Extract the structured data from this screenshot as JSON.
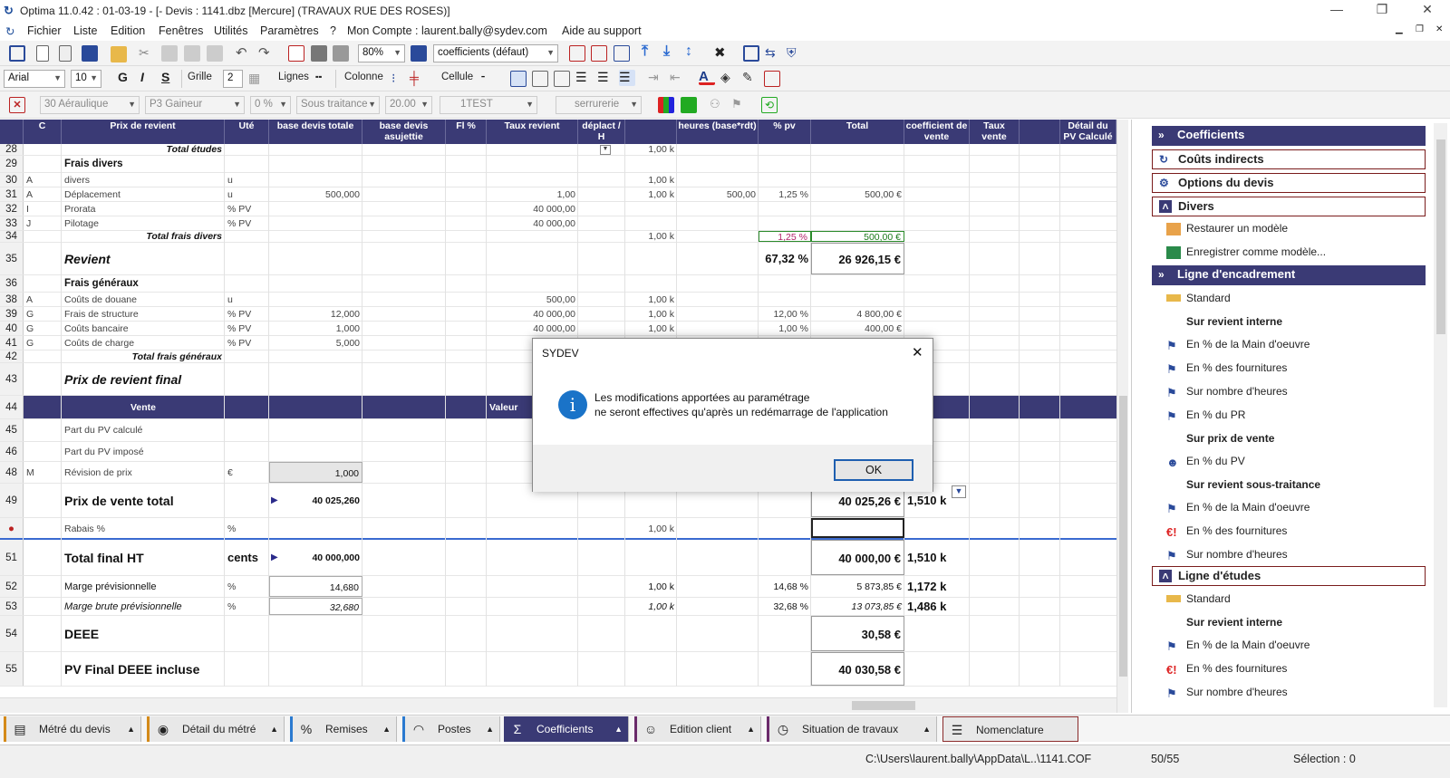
{
  "window": {
    "title": "Optima 11.0.42 : 01-03-19 - [- Devis : 1141.dbz [Mercure] (TRAVAUX RUE DES ROSES)]",
    "minimize": "—",
    "restore": "❐",
    "close": "✕"
  },
  "menu": [
    "Fichier",
    "Liste",
    "Edition",
    "Fenêtres",
    "Utilités",
    "Paramètres",
    "?",
    "Mon Compte : laurent.bally@sydev.com",
    "Aide au support"
  ],
  "toolbar1": {
    "zoom": "80%",
    "coef_select": "coefficients (défaut)"
  },
  "toolbar2": {
    "font": "Arial",
    "size": "10",
    "bold": "G",
    "italic": "I",
    "strike": "S",
    "grille": "Grille",
    "grille_val": "2",
    "lignes": "Lignes",
    "colonne": "Colonne",
    "cellule": "Cellule"
  },
  "toolbar3": {
    "aeraulique": "30 Aéraulique",
    "gaineur": "P3 Gaineur",
    "pct": "0 %",
    "sous_traitance": "Sous traitance",
    "rate": "20.00",
    "test": "1TEST",
    "serrurerie": "serrurerie"
  },
  "columns": [
    "C",
    "Prix de revient",
    "Uté",
    "base devis totale",
    "base devis asujettie",
    "Fl %",
    "Taux revient",
    "déplact / H",
    "",
    "heures (base*rdt)",
    "% pv",
    "Total",
    "coefficient de vente",
    "Taux vente",
    "",
    "Détail du PV Calculé"
  ],
  "rows": [
    {
      "n": "28",
      "c": "",
      "label": "Total études",
      "lstyle": "bi-right",
      "u": "",
      "base": "",
      "taux": "",
      "k": "1,00 k",
      "h": "",
      "pv": "",
      "total": ""
    },
    {
      "n": "29",
      "c": "",
      "label": "Frais divers",
      "lstyle": "b",
      "u": "",
      "base": "",
      "taux": "",
      "k": "",
      "h": "",
      "pv": "",
      "total": ""
    },
    {
      "n": "30",
      "c": "A",
      "label": "divers",
      "u": "u",
      "base": "",
      "taux": "",
      "k": "1,00 k",
      "h": "",
      "pv": "",
      "total": ""
    },
    {
      "n": "31",
      "c": "A",
      "label": "Déplacement",
      "u": "u",
      "base": "500,000",
      "taux": "1,00",
      "k": "1,00 k",
      "h": "500,00",
      "pv": "1,25 %",
      "total": "500,00 €"
    },
    {
      "n": "32",
      "c": "I",
      "label": "Prorata",
      "u": "% PV",
      "base": "",
      "taux": "40 000,00",
      "k": "",
      "h": "",
      "pv": "",
      "total": ""
    },
    {
      "n": "33",
      "c": "J",
      "label": "Pilotage",
      "u": "% PV",
      "base": "",
      "taux": "40 000,00",
      "k": "",
      "h": "",
      "pv": "",
      "total": ""
    },
    {
      "n": "34",
      "c": "",
      "label": "Total frais divers",
      "lstyle": "bi-right",
      "u": "",
      "base": "",
      "taux": "",
      "k": "1,00 k",
      "h": "",
      "pv": "1,25 %",
      "total": "500,00 €"
    },
    {
      "n": "35",
      "c": "",
      "label": "Revient",
      "lstyle": "big-i",
      "u": "",
      "base": "",
      "taux": "",
      "k": "",
      "h": "",
      "pv": "67,32 %",
      "total": "26 926,15 €"
    },
    {
      "n": "36",
      "c": "",
      "label": "Frais généraux",
      "lstyle": "b",
      "u": "",
      "base": "",
      "taux": "",
      "k": "",
      "h": "",
      "pv": "",
      "total": ""
    },
    {
      "n": "38",
      "c": "A",
      "label": "Coûts de douane",
      "u": "u",
      "base": "",
      "taux": "500,00",
      "k": "1,00 k",
      "h": "",
      "pv": "",
      "total": ""
    },
    {
      "n": "39",
      "c": "G",
      "label": "Frais de structure",
      "u": "% PV",
      "base": "12,000",
      "taux": "40 000,00",
      "k": "1,00 k",
      "h": "",
      "pv": "12,00 %",
      "total": "4 800,00 €"
    },
    {
      "n": "40",
      "c": "G",
      "label": "Coûts bancaire",
      "u": "% PV",
      "base": "1,000",
      "taux": "40 000,00",
      "k": "1,00 k",
      "h": "",
      "pv": "1,00 %",
      "total": "400,00 €"
    },
    {
      "n": "41",
      "c": "G",
      "label": "Coûts de charge",
      "u": "% PV",
      "base": "5,000",
      "taux": "40 000,00",
      "k": "1,00 k",
      "h": "",
      "pv": "5,00 %",
      "total": "2 000,00 €"
    },
    {
      "n": "42",
      "c": "",
      "label": "Total frais généraux",
      "lstyle": "bi-right",
      "u": "",
      "base": "",
      "taux": "",
      "k": "",
      "h": "",
      "pv": "",
      "total": ""
    },
    {
      "n": "43",
      "c": "",
      "label": "Prix de revient final",
      "lstyle": "big-i",
      "u": "",
      "base": "",
      "taux": "",
      "k": "",
      "h": "",
      "pv": "",
      "total": ""
    },
    {
      "n": "44",
      "c": "",
      "label": "Vente",
      "lstyle": "hdr",
      "u": "",
      "base": "",
      "taux": "Valeur",
      "k": "",
      "h": "",
      "pv": "",
      "total": ""
    },
    {
      "n": "45",
      "c": "",
      "label": "Part du PV calculé",
      "u": "",
      "base": "",
      "taux": "2",
      "k": "",
      "h": "",
      "pv": "",
      "total": ""
    },
    {
      "n": "46",
      "c": "",
      "label": "Part du PV imposé",
      "u": "",
      "base": "",
      "taux": "",
      "k": "",
      "h": "",
      "pv": "",
      "total": ""
    },
    {
      "n": "48",
      "c": "M",
      "label": "Révision de prix",
      "u": "€",
      "base": "1,000",
      "taux": "",
      "k": "",
      "h": "",
      "pv": "",
      "total": ""
    },
    {
      "n": "49",
      "c": "",
      "label": "Prix de vente total",
      "lstyle": "big",
      "u": "",
      "base": "40 025,260",
      "taux": "",
      "k": "",
      "h": "",
      "pv": "",
      "total": "40 025,26 €",
      "coef": "1,510 k"
    },
    {
      "n": "●",
      "c": "",
      "label": "Rabais %",
      "u": "%",
      "base": "",
      "taux": "",
      "k": "1,00 k",
      "h": "",
      "pv": "",
      "total": ""
    },
    {
      "n": "51",
      "c": "",
      "label": "Total final HT",
      "lstyle": "big",
      "u": "cents",
      "base": "40 000,000",
      "taux": "",
      "k": "",
      "h": "",
      "pv": "",
      "total": "40 000,00 €",
      "coef": "1,510 k"
    },
    {
      "n": "52",
      "c": "",
      "label": "Marge prévisionnelle",
      "lstyle": "m",
      "u": "%",
      "base": "14,680",
      "taux": "",
      "k": "1,00 k",
      "h": "",
      "pv": "14,68 %",
      "total": "5 873,85 €",
      "coef": "1,172 k"
    },
    {
      "n": "53",
      "c": "",
      "label": "Marge brute prévisionnelle",
      "lstyle": "mi",
      "u": "%",
      "base": "32,680",
      "taux": "",
      "k": "1,00 k",
      "h": "",
      "pv": "32,68 %",
      "total": "13 073,85 €",
      "coef": "1,486 k"
    },
    {
      "n": "54",
      "c": "",
      "label": "DEEE",
      "lstyle": "big",
      "u": "",
      "base": "",
      "taux": "",
      "k": "",
      "h": "",
      "pv": "",
      "total": "30,58 €"
    },
    {
      "n": "55",
      "c": "",
      "label": "PV Final DEEE incluse",
      "lstyle": "big",
      "u": "",
      "base": "",
      "taux": "",
      "k": "",
      "h": "",
      "pv": "",
      "total": "40 030,58 €"
    }
  ],
  "side": {
    "coefficients": "Coefficients",
    "couts": "Coûts indirects",
    "options": "Options du devis",
    "divers": "Divers",
    "restaurer": "Restaurer un modèle",
    "enregistrer": "Enregistrer comme modèle...",
    "encadrement": "Ligne d'encadrement",
    "standard": "Standard",
    "sri": "Sur revient interne",
    "mo": "En % de la Main d'oeuvre",
    "four": "En % des fournitures",
    "heures": "Sur nombre d'heures",
    "pr": "En % du PR",
    "spv": "Sur prix de vente",
    "pv": "En % du PV",
    "srst": "Sur revient sous-traitance",
    "etudes": "Ligne d'études"
  },
  "tabs": [
    "Métré du devis",
    "Détail du métré",
    "Remises",
    "Postes",
    "Coefficients",
    "Edition client",
    "Situation de travaux",
    "Nomenclature"
  ],
  "status": {
    "path": "C:\\Users\\laurent.bally\\AppData\\L..\\1141.COF",
    "pos": "50/55",
    "sel": "Sélection : 0"
  },
  "dialog": {
    "title": "SYDEV",
    "line1": "Les modifications apportées au paramétrage",
    "line2": "ne seront effectives qu'après un redémarrage de l'application",
    "ok": "OK",
    "close": "✕"
  }
}
